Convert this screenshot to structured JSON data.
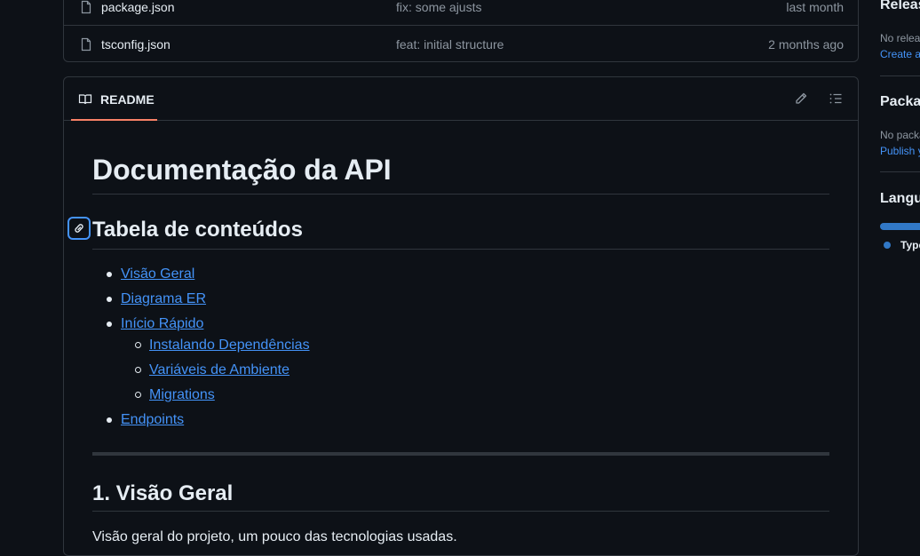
{
  "files": [
    {
      "name": "package.json",
      "commit": "fix: some ajusts",
      "date": "last month",
      "icon": "file-icon"
    },
    {
      "name": "tsconfig.json",
      "commit": "feat: initial structure",
      "date": "2 months ago",
      "icon": "file-icon"
    }
  ],
  "readme": {
    "tab_label": "README",
    "tab_icon": "book-icon",
    "edit_icon": "pencil-icon",
    "outline_icon": "list-icon",
    "h1": "Documentação da API",
    "toc_heading": "Tabela de conteúdos",
    "toc": [
      {
        "label": "Visão Geral",
        "level": 1
      },
      {
        "label": "Diagrama ER",
        "level": 1
      },
      {
        "label": "Início Rápido",
        "level": 1
      },
      {
        "label": "Instalando Dependências",
        "level": 2
      },
      {
        "label": "Variáveis de Ambiente",
        "level": 2
      },
      {
        "label": "Migrations",
        "level": 2
      },
      {
        "label": "Endpoints",
        "level": 1
      }
    ],
    "section_heading": "1. Visão Geral",
    "section_text": "Visão geral do projeto, um pouco das tecnologias usadas."
  },
  "sidebar": {
    "releases_title": "Releases",
    "releases_empty": "No releases published",
    "releases_link": "Create a new release",
    "packages_title": "Packages",
    "packages_empty": "No packages published",
    "packages_link": "Publish your first package",
    "languages_title": "Languages",
    "language_name": "TypeScript",
    "language_color": "#3178c6"
  },
  "colors": {
    "background": "#0d1117",
    "border": "#30363d",
    "link": "#4493f8",
    "muted": "#8d96a0",
    "tab_accent": "#f78166"
  }
}
